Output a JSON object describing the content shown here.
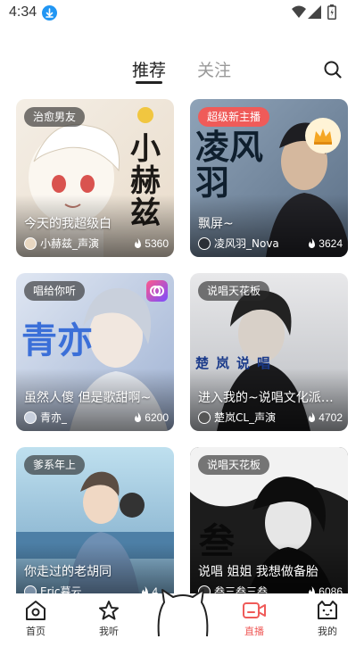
{
  "status_bar": {
    "time": "4:34",
    "icons": [
      "download-icon",
      "wifi-icon",
      "signal-icon",
      "battery-icon"
    ]
  },
  "tabs": [
    {
      "label": "推荐",
      "active": true
    },
    {
      "label": "关注",
      "active": false
    }
  ],
  "search": {
    "icon": "search-icon"
  },
  "cards": [
    {
      "tag": "治愈男友",
      "title": "今天的我超级白",
      "host": "小赫兹_声演",
      "heat": "5360",
      "art_text": "小赫兹"
    },
    {
      "tag": "超级新主播",
      "title": "飘屏~",
      "host": "凌风羽_Nova",
      "heat": "3624",
      "art_text": "凌风羽"
    },
    {
      "tag": "唱给你听",
      "title": "虽然人傻 但是歌甜啊~",
      "host": "青亦_",
      "heat": "6200",
      "art_text": "青亦"
    },
    {
      "tag": "说唱天花板",
      "title": "进入我的~说唱文化派对...",
      "host": "楚岚CL_声演",
      "heat": "4702",
      "art_text": "楚岚说唱"
    },
    {
      "tag": "爹系年上",
      "title": "你走过的老胡同",
      "host": "Eric暮云",
      "heat": "4…",
      "art_text": ""
    },
    {
      "tag": "说唱天花板",
      "title": "说唱 姐姐 我想做备胎",
      "host": "叁三叁三叁",
      "heat": "6086",
      "art_text": "叁"
    }
  ],
  "bottom_nav": [
    {
      "label": "首页",
      "icon": "home-icon",
      "active": false
    },
    {
      "label": "我听",
      "icon": "star-icon",
      "active": false
    },
    {
      "label": "",
      "icon": "cat-center-icon",
      "active": false
    },
    {
      "label": "直播",
      "icon": "live-camera-icon",
      "active": true
    },
    {
      "label": "我的",
      "icon": "cat-face-icon",
      "active": false
    }
  ],
  "colors": {
    "accent": "#ef5b59",
    "tag_bg": "#3a3a3a",
    "text_primary": "#222222",
    "text_secondary": "#999999"
  }
}
